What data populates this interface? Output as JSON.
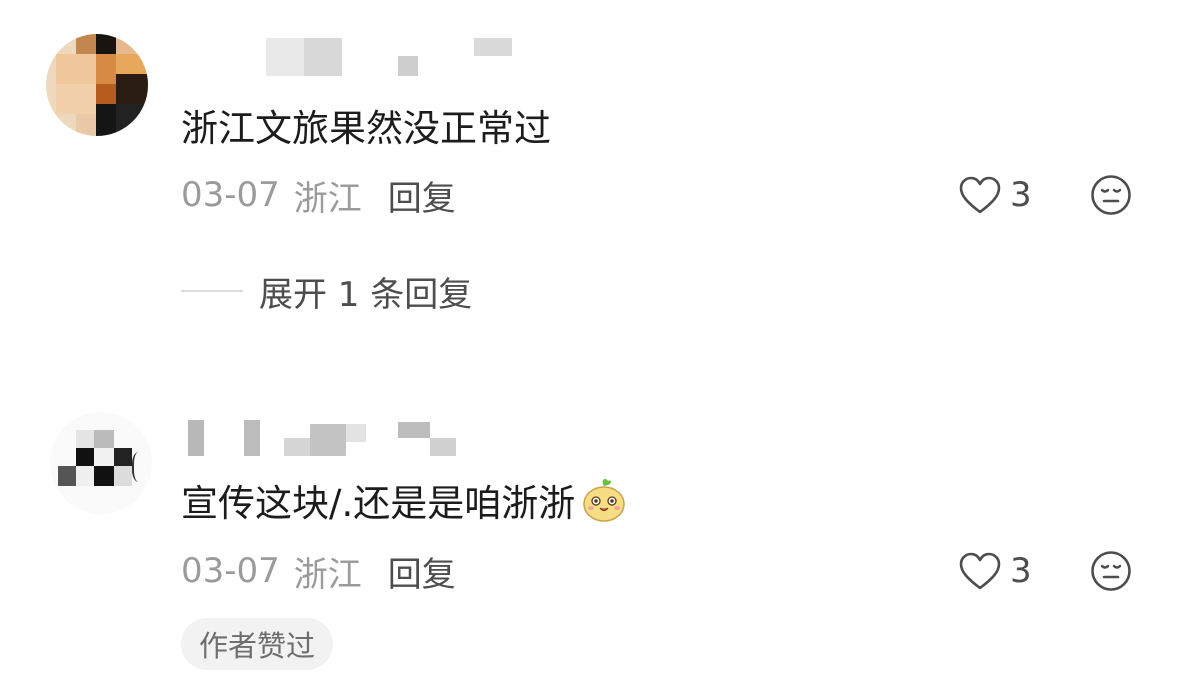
{
  "comments": [
    {
      "text": "浙江文旅果然没正常过",
      "date": "03-07",
      "location": "浙江",
      "reply_label": "回复",
      "like_count": "3",
      "expand_label": "展开 1 条回复"
    },
    {
      "text": "宣传这块/.还是是咱浙浙",
      "date": "03-07",
      "location": "浙江",
      "reply_label": "回复",
      "like_count": "3",
      "author_liked": "作者赞过"
    }
  ],
  "icons": {
    "like": "heart-outline-icon",
    "emoji": "neutral-face-icon",
    "sticker": "cartoon-face-sticker"
  },
  "colors": {
    "text": "#1c1c1c",
    "meta": "#9b9b9b",
    "action": "#4d4d4d",
    "badge_bg": "#f2f2f2"
  }
}
